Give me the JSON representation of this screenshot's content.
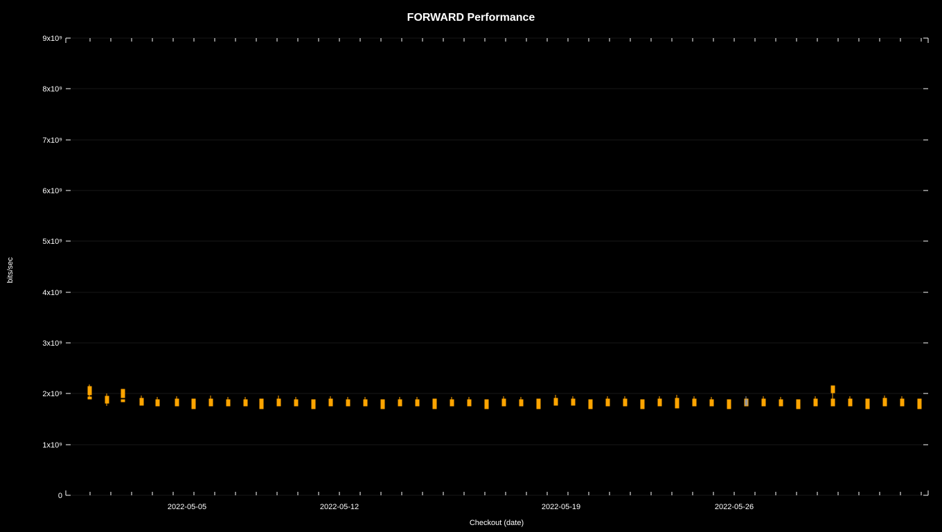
{
  "chart": {
    "title": "FORWARD Performance",
    "x_axis_label": "Checkout (date)",
    "y_axis_label": "bits/sec",
    "background": "#000000",
    "y_axis": {
      "ticks": [
        {
          "label": "0",
          "value": 0
        },
        {
          "label": "1x10⁹",
          "value": 1
        },
        {
          "label": "2x10⁹",
          "value": 2
        },
        {
          "label": "3x10⁹",
          "value": 3
        },
        {
          "label": "4x10⁹",
          "value": 4
        },
        {
          "label": "5x10⁹",
          "value": 5
        },
        {
          "label": "6x10⁹",
          "value": 6
        },
        {
          "label": "7x10⁹",
          "value": 7
        },
        {
          "label": "8x10⁹",
          "value": 8
        },
        {
          "label": "9x10⁹",
          "value": 9
        }
      ]
    },
    "x_axis": {
      "ticks": [
        {
          "label": "2022-05-05"
        },
        {
          "label": "2022-05-12"
        },
        {
          "label": "2022-05-19"
        },
        {
          "label": "2022-05-26"
        }
      ]
    },
    "data_color": "#FFA500",
    "tick_color": "#ffffff"
  }
}
